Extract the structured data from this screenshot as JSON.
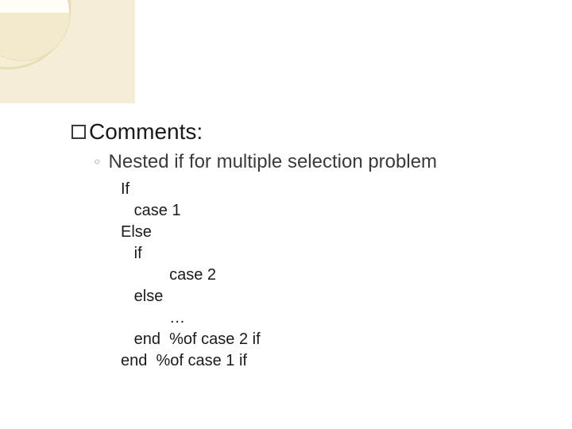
{
  "heading": "Comments:",
  "subheading": "Nested if for multiple selection problem",
  "code": {
    "l0": "If",
    "l1": "   case 1",
    "l2": "Else",
    "l3": "   if",
    "l4": "           case 2",
    "l5": "   else",
    "l6": "           …",
    "l7": "   end  %of case 2 if",
    "l8": "end  %of case 1 if"
  }
}
